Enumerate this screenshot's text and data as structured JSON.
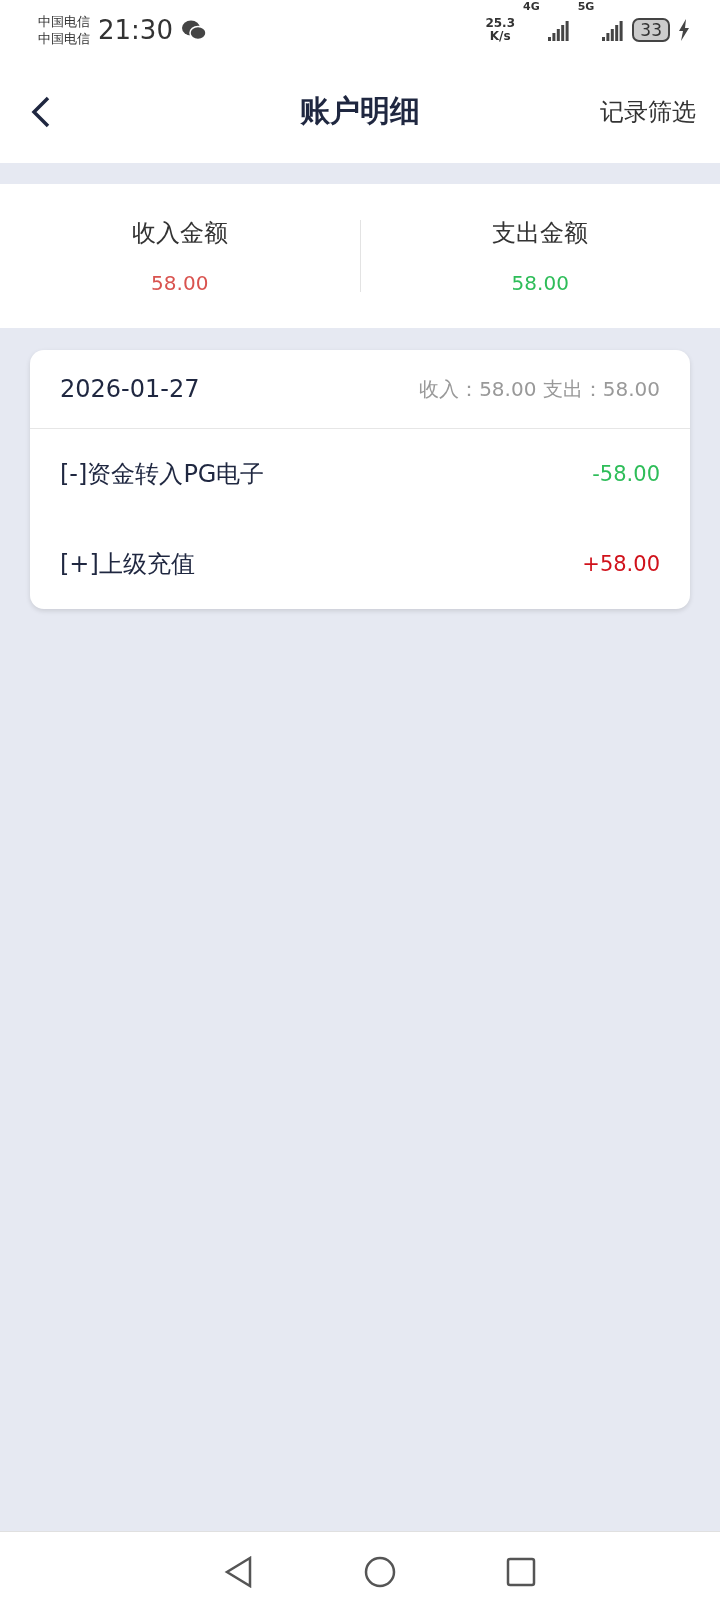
{
  "status_bar": {
    "carriers": [
      "中国电信",
      "中国电信"
    ],
    "time": "21:30",
    "net_speed": "25.3",
    "net_unit": "K/s",
    "network_1": "4G",
    "network_2": "5G",
    "battery": "33"
  },
  "header": {
    "title": "账户明细",
    "action": "记录筛选"
  },
  "summary": [
    {
      "kind": "income",
      "label": "收入金额",
      "amount": "58.00"
    },
    {
      "kind": "expense",
      "label": "支出金额",
      "amount": "58.00"
    }
  ],
  "days": [
    {
      "date": "2026-01-27",
      "totals": "收入：58.00 支出：58.00",
      "entries": [
        {
          "kind": "expense",
          "label": "[-]资金转入PG电子",
          "amount": "-58.00"
        },
        {
          "kind": "income",
          "label": "[+]上级充值",
          "amount": "+58.00"
        }
      ]
    }
  ]
}
